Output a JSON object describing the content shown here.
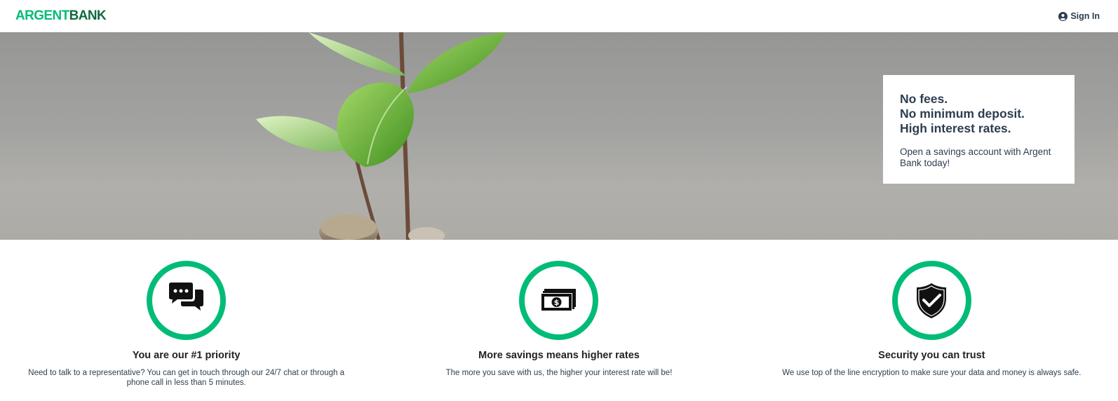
{
  "nav": {
    "logo_part1": "ARGENT",
    "logo_part2": "BANK",
    "signin_label": "Sign In"
  },
  "hero": {
    "subtitles": [
      "No fees.",
      "No minimum deposit.",
      "High interest rates."
    ],
    "text": "Open a savings account with Argent Bank today!"
  },
  "features": [
    {
      "icon": "chat-icon",
      "title": "You are our #1 priority",
      "text": "Need to talk to a representative? You can get in touch through our 24/7 chat or through a phone call in less than 5 minutes."
    },
    {
      "icon": "money-icon",
      "title": "More savings means higher rates",
      "text": "The more you save with us, the higher your interest rate will be!"
    },
    {
      "icon": "security-shield-icon",
      "title": "Security you can trust",
      "text": "We use top of the line encryption to make sure your data and money is always safe."
    }
  ],
  "colors": {
    "brand_green": "#00bc77",
    "brand_dark_green": "#0f6b40",
    "text": "#2c3e50"
  }
}
